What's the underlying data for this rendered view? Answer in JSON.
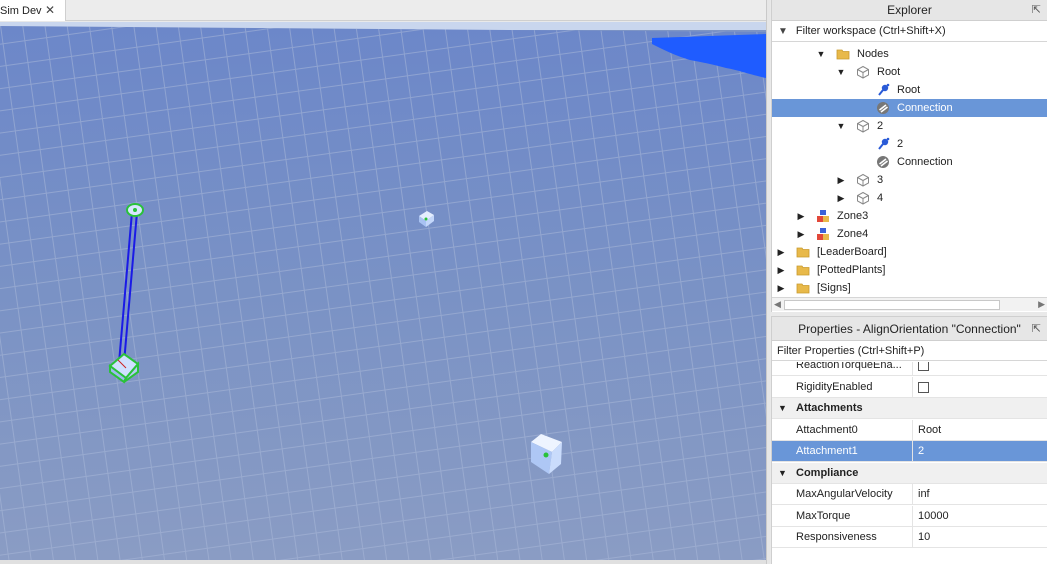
{
  "document_tab": {
    "label": "Sim Dev",
    "close": "✕"
  },
  "explorer": {
    "title": "Explorer",
    "filter_placeholder": "Filter workspace (Ctrl+Shift+X)",
    "tree": [
      {
        "label": "Nodes",
        "icon": "folder-icon",
        "arrow": "▼",
        "depth": 3
      },
      {
        "label": "Root",
        "icon": "model-icon",
        "arrow": "▼",
        "depth": 4
      },
      {
        "label": "Root",
        "icon": "attachment-icon",
        "arrow": "",
        "depth": 5
      },
      {
        "label": "Connection",
        "icon": "align-orientation-icon",
        "arrow": "",
        "depth": 5,
        "selected": true
      },
      {
        "label": "2",
        "icon": "model-icon",
        "arrow": "▼",
        "depth": 4
      },
      {
        "label": "2",
        "icon": "attachment-icon",
        "arrow": "",
        "depth": 5
      },
      {
        "label": "Connection",
        "icon": "align-orientation-icon",
        "arrow": "",
        "depth": 5
      },
      {
        "label": "3",
        "icon": "model-icon",
        "arrow": "▶",
        "depth": 4
      },
      {
        "label": "4",
        "icon": "model-icon",
        "arrow": "▶",
        "depth": 4
      },
      {
        "label": "Zone3",
        "icon": "zone-icon",
        "arrow": "▶",
        "depth": 2
      },
      {
        "label": "Zone4",
        "icon": "zone-icon",
        "arrow": "▶",
        "depth": 2
      },
      {
        "label": "[LeaderBoard]",
        "icon": "folder-icon",
        "arrow": "▶",
        "depth": 1
      },
      {
        "label": "[PottedPlants]",
        "icon": "folder-icon",
        "arrow": "▶",
        "depth": 1
      },
      {
        "label": "[Signs]",
        "icon": "folder-icon",
        "arrow": "▶",
        "depth": 1
      }
    ]
  },
  "properties": {
    "title": "Properties - AlignOrientation \"Connection\"",
    "filter_placeholder": "Filter Properties (Ctrl+Shift+P)",
    "rows": [
      {
        "type": "prop",
        "name": "ReactionTorqueEna...",
        "kind": "checkbox",
        "value": ""
      },
      {
        "type": "prop",
        "name": "RigidityEnabled",
        "kind": "checkbox",
        "value": ""
      },
      {
        "type": "cat",
        "name": "Attachments"
      },
      {
        "type": "prop",
        "name": "Attachment0",
        "kind": "text",
        "value": "Root"
      },
      {
        "type": "prop",
        "name": "Attachment1",
        "kind": "text",
        "value": "2",
        "selected": true
      },
      {
        "type": "cat",
        "name": "Compliance"
      },
      {
        "type": "prop",
        "name": "MaxAngularVelocity",
        "kind": "text",
        "value": "inf"
      },
      {
        "type": "prop",
        "name": "MaxTorque",
        "kind": "text",
        "value": "10000"
      },
      {
        "type": "prop",
        "name": "Responsiveness",
        "kind": "text",
        "value": "10"
      }
    ]
  },
  "colors": {
    "selection": "#6996d8",
    "baseplate": "#7e95c4",
    "water": "#1f5cff",
    "constraint_line": "#1a1ae6",
    "attachment_green": "#29c23a"
  }
}
